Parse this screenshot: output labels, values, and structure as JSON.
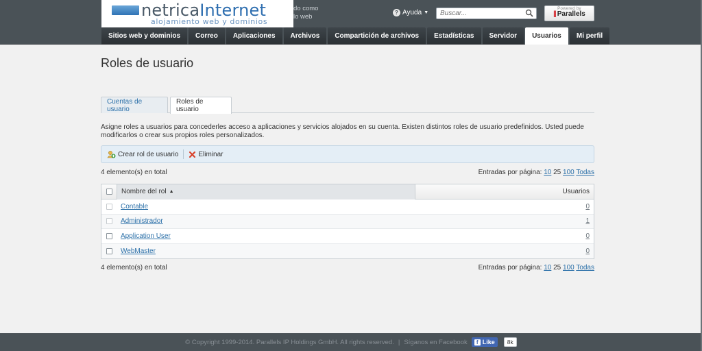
{
  "header": {
    "logo_main_1": "netrica",
    "logo_main_2": "Internet",
    "logo_sub": "alojamiento web y dominios",
    "logged_line1": "do como",
    "logged_line2": "lo web",
    "help_label": "Ayuda",
    "search_placeholder": "Buscar...",
    "powered_by": "Powered by",
    "parallels_name": "Parallels"
  },
  "nav": {
    "tabs": [
      {
        "label": "Sitios web y dominios",
        "active": false
      },
      {
        "label": "Correo",
        "active": false
      },
      {
        "label": "Aplicaciones",
        "active": false
      },
      {
        "label": "Archivos",
        "active": false
      },
      {
        "label": "Compartición de archivos",
        "active": false
      },
      {
        "label": "Estadísticas",
        "active": false
      },
      {
        "label": "Servidor",
        "active": false
      },
      {
        "label": "Usuarios",
        "active": true
      },
      {
        "label": "Mi perfil",
        "active": false
      }
    ]
  },
  "page": {
    "title": "Roles de usuario",
    "tab_accounts": "Cuentas de usuario",
    "tab_roles": "Roles de usuario",
    "description": "Asigne roles a usuarios para concederles acceso a aplicaciones y servicios alojados en su cuenta. Existen distintos roles de usuario predefinidos. Usted puede modificarlos o crear sus propios roles personalizados."
  },
  "toolbar": {
    "create_label": "Crear rol de usuario",
    "delete_label": "Eliminar"
  },
  "list": {
    "total_text": "4 elemento(s) en total",
    "per_page_label": "Entradas por página:",
    "per_page_10": "10",
    "per_page_25": "25",
    "per_page_100": "100",
    "per_page_all": "Todas",
    "col_name": "Nombre del rol",
    "col_users": "Usuarios",
    "rows": [
      {
        "name": "Contable",
        "users": "0"
      },
      {
        "name": "Administrador",
        "users": "1"
      },
      {
        "name": "Application User",
        "users": "0"
      },
      {
        "name": "WebMaster",
        "users": "0"
      }
    ]
  },
  "footer": {
    "copyright": "© Copyright 1999-2014. Parallels IP Holdings GmbH. All rights reserved.",
    "separator": "|",
    "follow": "Síganos en Facebook",
    "like_label": "Like",
    "like_count": "8k"
  }
}
